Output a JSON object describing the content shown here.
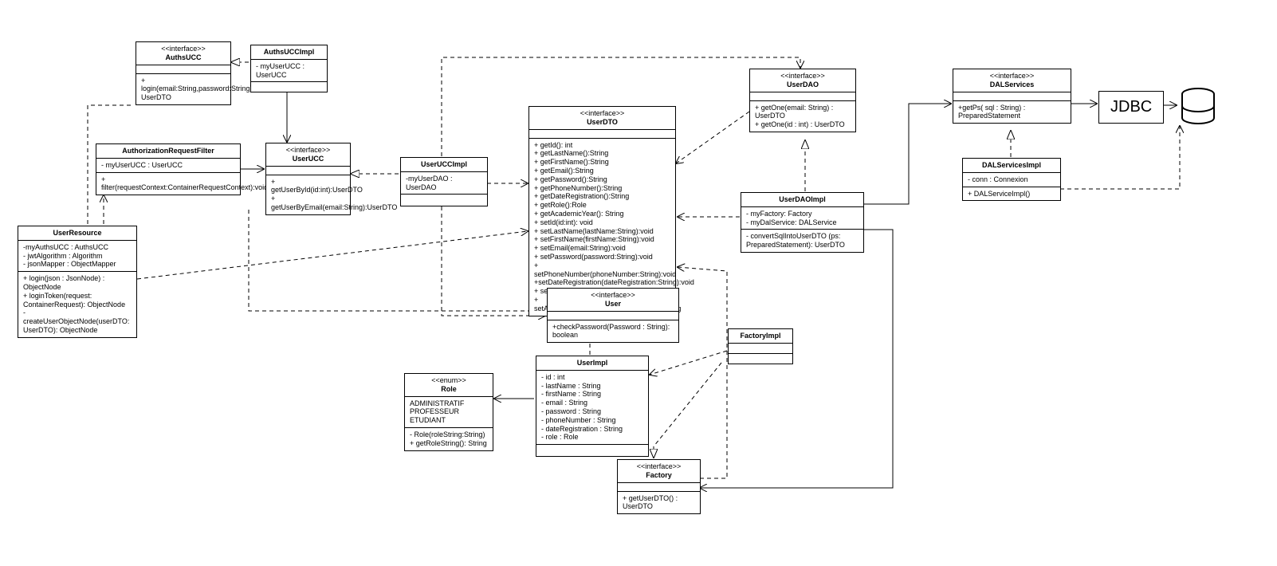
{
  "chart_data": {
    "type": "uml_class_diagram",
    "classes": [
      {
        "id": "AuthsUCC",
        "stereotype": "<<interface>>",
        "name": "AuthsUCC",
        "attributes": [],
        "operations": [
          "+ login(email:String,password:String): UserDTO"
        ]
      },
      {
        "id": "AuthsUCCImpl",
        "stereotype": "",
        "name": "AuthsUCCImpl",
        "attributes": [
          "- myUserUCC : UserUCC"
        ],
        "operations": []
      },
      {
        "id": "AuthorizationRequestFilter",
        "stereotype": "",
        "name": "AuthorizationRequestFilter",
        "attributes": [
          "- myUserUCC : UserUCC"
        ],
        "operations": [
          "+ filter(requestContext:ContainerRequestContext):void"
        ]
      },
      {
        "id": "UserUCC",
        "stereotype": "<<interface>>",
        "name": "UserUCC",
        "attributes": [],
        "operations": [
          "+ getUserById(id:int):UserDTO",
          "+ getUserByEmail(email:String):UserDTO"
        ]
      },
      {
        "id": "UserResource",
        "stereotype": "",
        "name": "UserResource",
        "attributes": [
          "-myAuthsUCC : AuthsUCC",
          "- jwtAlgorithm : Algorithm",
          "- jsonMapper : ObjectMapper"
        ],
        "operations": [
          "+ login(json : JsonNode) : ObjectNode",
          "+ loginToken(request: ContainerRequest): ObjectNode",
          "- createUserObjectNode(userDTO: UserDTO): ObjectNode"
        ]
      },
      {
        "id": "UserUCCImpl",
        "stereotype": "",
        "name": "UserUCCImpl",
        "attributes": [
          "-myUserDAO : UserDAO"
        ],
        "operations": []
      },
      {
        "id": "UserDTO",
        "stereotype": "<<interface>>",
        "name": "UserDTO",
        "attributes": [],
        "operations": [
          "+ getId(): int",
          "+ getLastName():String",
          "+ getFirstName():String",
          "+ getEmail():String",
          "+ getPassword():String",
          "+ getPhoneNumber():String",
          "+ getDateRegistration():String",
          "+ getRole():Role",
          "+ getAcademicYear(): String",
          "+ setId(id:int): void",
          "+ setLastName(lastName:String):void",
          "+ setFirstName(firstName:String):void",
          "+ setEmail(email:String):void",
          "+ setPassword(password:String):void",
          "+ setPhoneNumber(phoneNumber:String):void",
          "+setDateRegistration(dateRegistration:String):void",
          "+ setRole(role:Role):void",
          "+ setAcademicYear(academicYear:String):String"
        ]
      },
      {
        "id": "UserDAO",
        "stereotype": "<<interface>>",
        "name": "UserDAO",
        "attributes": [],
        "operations": [
          "+ getOne(email: String) : UserDTO",
          "+ getOne(id : int) : UserDTO"
        ]
      },
      {
        "id": "DALServices",
        "stereotype": "<<interface>>",
        "name": "DALServices",
        "attributes": [],
        "operations": [
          "+getPs( sql : String) : PreparedStatement"
        ]
      },
      {
        "id": "DALServicesImpl",
        "stereotype": "",
        "name": "DALServicesImpl",
        "attributes": [
          "- conn : Connexion"
        ],
        "operations": [
          "+ DALServiceImpl()"
        ]
      },
      {
        "id": "UserDAOImpl",
        "stereotype": "",
        "name": "UserDAOImpl",
        "attributes": [
          "- myFactory: Factory",
          "- myDalService: DALService"
        ],
        "operations": [
          "- convertSqlIntoUserDTO (ps: PreparedStatement): UserDTO"
        ]
      },
      {
        "id": "User",
        "stereotype": "<<interface>>",
        "name": "User",
        "attributes": [],
        "operations": [
          "+checkPassword(Password : String): boolean"
        ]
      },
      {
        "id": "FactoryImpl",
        "stereotype": "",
        "name": "FactoryImpl",
        "attributes": [],
        "operations": []
      },
      {
        "id": "UserImpl",
        "stereotype": "",
        "name": "UserImpl",
        "attributes": [
          "- id : int",
          "- lastName : String",
          "- firstName : String",
          "- email : String",
          "- password : String",
          "- phoneNumber : String",
          "- dateRegistration : String",
          "- role : Role"
        ],
        "operations": []
      },
      {
        "id": "Role",
        "stereotype": "<<enum>>",
        "name": "Role",
        "attributes": [
          "ADMINISTRATIF",
          "PROFESSEUR",
          "ETUDIANT"
        ],
        "operations": [
          "- Role(roleString:String)",
          "+ getRoleString(): String"
        ]
      },
      {
        "id": "Factory",
        "stereotype": "<<interface>>",
        "name": "Factory",
        "attributes": [],
        "operations": [
          "+ getUserDTO() : UserDTO"
        ]
      }
    ],
    "relations": [
      {
        "from": "AuthsUCCImpl",
        "to": "AuthsUCC",
        "type": "realization"
      },
      {
        "from": "AuthsUCCImpl",
        "to": "UserUCC",
        "type": "association"
      },
      {
        "from": "AuthorizationRequestFilter",
        "to": "UserUCC",
        "type": "association"
      },
      {
        "from": "UserResource",
        "to": "AuthsUCC",
        "type": "dependency"
      },
      {
        "from": "UserResource",
        "to": "AuthorizationRequestFilter",
        "type": "dependency"
      },
      {
        "from": "UserResource",
        "to": "UserDTO",
        "type": "dependency"
      },
      {
        "from": "UserUCCImpl",
        "to": "UserUCC",
        "type": "realization"
      },
      {
        "from": "UserUCCImpl",
        "to": "UserDAO",
        "type": "dependency"
      },
      {
        "from": "UserUCCImpl",
        "to": "UserDTO",
        "type": "dependency"
      },
      {
        "from": "UserUCCImpl",
        "to": "User",
        "type": "dependency"
      },
      {
        "from": "UserDAO",
        "to": "UserDTO",
        "type": "dependency"
      },
      {
        "from": "DALServicesImpl",
        "to": "DALServices",
        "type": "realization"
      },
      {
        "from": "DALServicesImpl",
        "to": "JDBC",
        "type": "dependency"
      },
      {
        "from": "UserDAOImpl",
        "to": "UserDAO",
        "type": "realization"
      },
      {
        "from": "UserDAOImpl",
        "to": "DALServices",
        "type": "association"
      },
      {
        "from": "UserDAOImpl",
        "to": "Factory",
        "type": "association"
      },
      {
        "from": "UserDAOImpl",
        "to": "UserDTO",
        "type": "dependency"
      },
      {
        "from": "User",
        "to": "UserDTO",
        "type": "generalization"
      },
      {
        "from": "UserImpl",
        "to": "User",
        "type": "realization"
      },
      {
        "from": "UserImpl",
        "to": "Role",
        "type": "association"
      },
      {
        "from": "FactoryImpl",
        "to": "Factory",
        "type": "realization"
      },
      {
        "from": "FactoryImpl",
        "to": "UserImpl",
        "type": "dependency"
      },
      {
        "from": "Factory",
        "to": "UserDTO",
        "type": "dependency"
      },
      {
        "from": "JDBC",
        "to": "Database",
        "type": "association"
      }
    ],
    "external": [
      "JDBC",
      "Database"
    ]
  },
  "labels": {
    "jdbc": "JDBC"
  }
}
